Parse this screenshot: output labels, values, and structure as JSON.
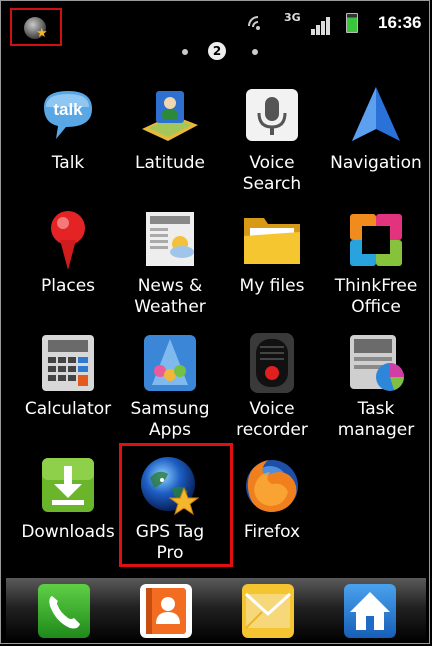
{
  "status_bar": {
    "time": "16:36",
    "network_type": "3G",
    "notification_icon": "gps-tag-pro-icon",
    "icons": [
      "wifi-icon",
      "signal-icon",
      "battery-icon"
    ]
  },
  "page_indicator": {
    "current": "2"
  },
  "apps": [
    {
      "label": "Talk",
      "icon": "talk-icon"
    },
    {
      "label": "Latitude",
      "icon": "latitude-icon"
    },
    {
      "label": "Voice Search",
      "icon": "microphone-icon"
    },
    {
      "label": "Navigation",
      "icon": "navigation-arrow-icon"
    },
    {
      "label": "Places",
      "icon": "places-pin-icon"
    },
    {
      "label": "News & Weather",
      "icon": "newspaper-icon"
    },
    {
      "label": "My files",
      "icon": "folder-icon"
    },
    {
      "label": "ThinkFree Office",
      "icon": "thinkfree-office-icon"
    },
    {
      "label": "Calculator",
      "icon": "calculator-icon"
    },
    {
      "label": "Samsung Apps",
      "icon": "samsung-apps-icon"
    },
    {
      "label": "Voice recorder",
      "icon": "voice-recorder-icon"
    },
    {
      "label": "Task manager",
      "icon": "task-manager-icon"
    },
    {
      "label": "Downloads",
      "icon": "download-icon"
    },
    {
      "label": "GPS Tag Pro",
      "icon": "gps-tag-pro-icon"
    },
    {
      "label": "Firefox",
      "icon": "firefox-icon"
    }
  ],
  "highlighted_app": "GPS Tag Pro",
  "colors": {
    "highlight": "#e01010",
    "background": "#000000"
  },
  "dock": [
    "phone-icon",
    "contacts-icon",
    "messaging-icon",
    "home-icon"
  ]
}
